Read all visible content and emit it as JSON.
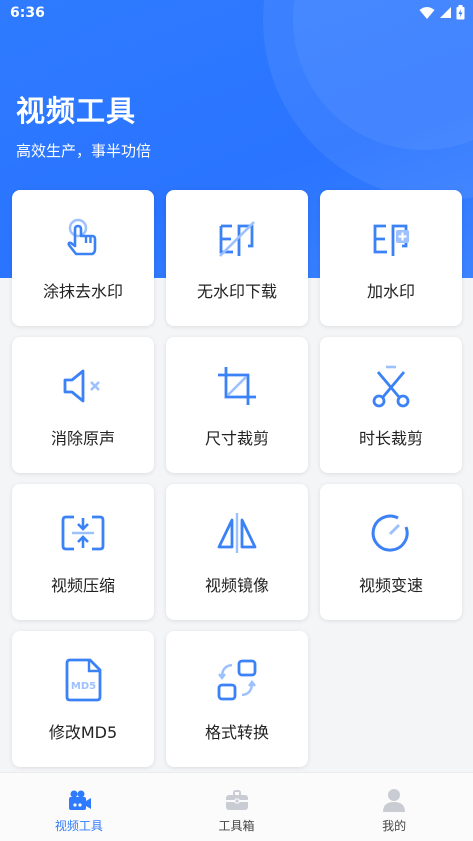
{
  "status_bar": {
    "time": "6:36"
  },
  "header": {
    "title": "视频工具",
    "subtitle": "高效生产，事半功倍"
  },
  "tools": [
    {
      "label": "涂抹去水印",
      "icon": "hand-pointer-icon"
    },
    {
      "label": "无水印下载",
      "icon": "watermark-off-icon"
    },
    {
      "label": "加水印",
      "icon": "watermark-add-icon"
    },
    {
      "label": "消除原声",
      "icon": "mute-icon"
    },
    {
      "label": "尺寸裁剪",
      "icon": "crop-icon"
    },
    {
      "label": "时长裁剪",
      "icon": "scissors-icon"
    },
    {
      "label": "视频压缩",
      "icon": "compress-icon"
    },
    {
      "label": "视频镜像",
      "icon": "mirror-icon"
    },
    {
      "label": "视频变速",
      "icon": "speed-icon"
    },
    {
      "label": "修改MD5",
      "icon": "md5-file-icon"
    },
    {
      "label": "格式转换",
      "icon": "convert-icon"
    }
  ],
  "bottom_nav": [
    {
      "label": "视频工具",
      "icon": "video-camera-icon",
      "active": true
    },
    {
      "label": "工具箱",
      "icon": "toolbox-icon",
      "active": false
    },
    {
      "label": "我的",
      "icon": "user-icon",
      "active": false
    }
  ],
  "colors": {
    "accent": "#2f7bff",
    "icon_blue": "#3b82f6",
    "icon_light": "#9dc1ff"
  }
}
